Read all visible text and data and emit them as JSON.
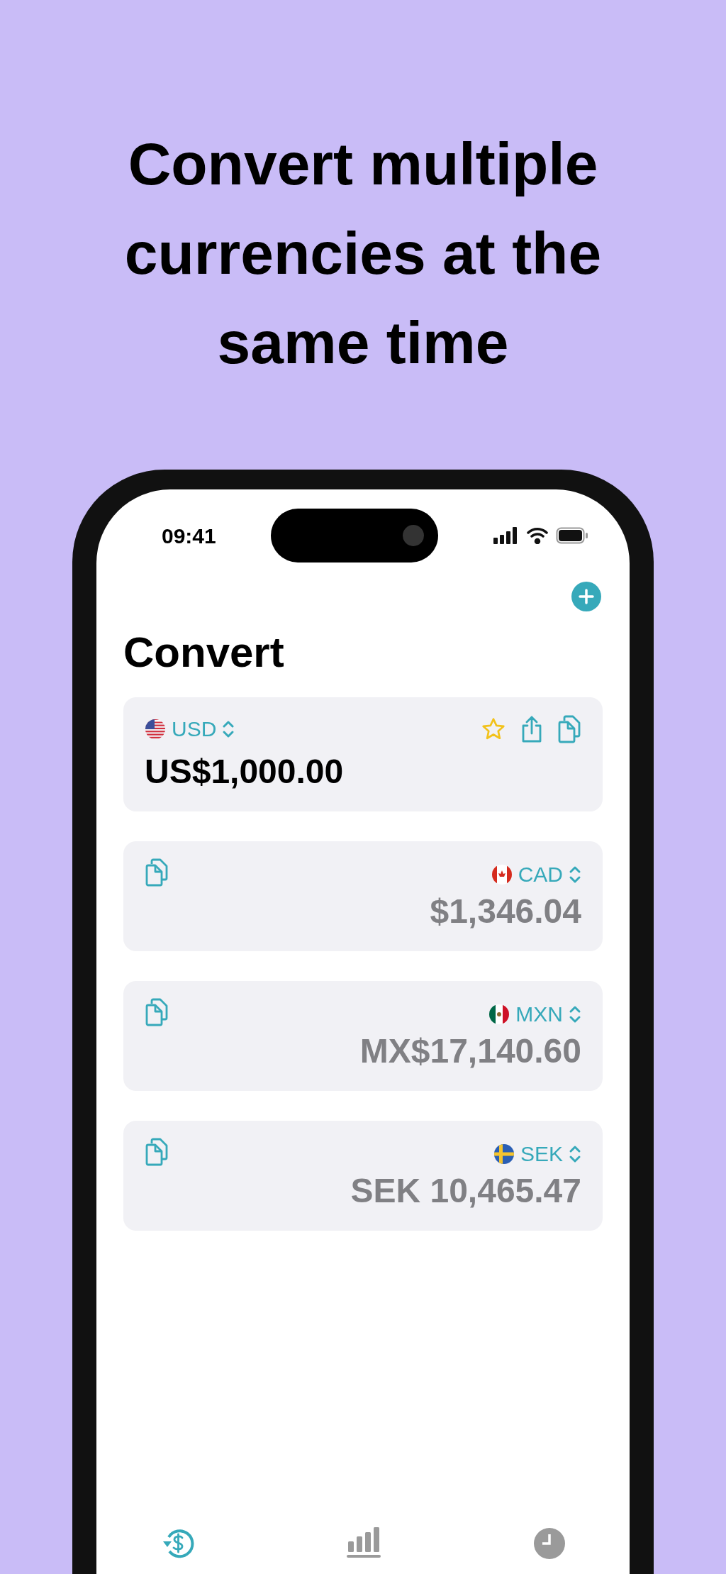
{
  "headline": "Convert multiple currencies at the same time",
  "status_bar": {
    "time": "09:41"
  },
  "screen": {
    "title": "Convert"
  },
  "currencies": [
    {
      "kind": "base",
      "code": "USD",
      "flag": {
        "kind": "us"
      },
      "amount": "US$1,000.00"
    },
    {
      "kind": "converted",
      "code": "CAD",
      "flag": {
        "kind": "ca"
      },
      "amount": "$1,346.04"
    },
    {
      "kind": "converted",
      "code": "MXN",
      "flag": {
        "kind": "mx"
      },
      "amount": "MX$17,140.60"
    },
    {
      "kind": "converted",
      "code": "SEK",
      "flag": {
        "kind": "se"
      },
      "amount": "SEK 10,465.47"
    }
  ],
  "tabs": [
    {
      "kind": "convert",
      "selected": true
    },
    {
      "kind": "charts",
      "selected": false
    },
    {
      "kind": "history",
      "selected": false
    }
  ]
}
